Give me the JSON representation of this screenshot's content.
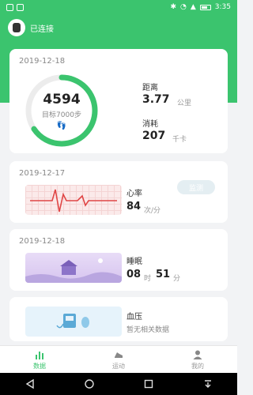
{
  "status": {
    "time": "3:35"
  },
  "device": {
    "connection_status": "已连接"
  },
  "steps_card": {
    "date": "2019-12-18",
    "steps": "4594",
    "target": "目标7000步",
    "progress": 0.656,
    "distance_label": "距离",
    "distance_value": "3.77",
    "distance_unit": "公里",
    "calorie_label": "消耗",
    "calorie_value": "207",
    "calorie_unit": "千卡"
  },
  "heart_card": {
    "date": "2019-12-17",
    "label": "心率",
    "value": "84",
    "unit": "次/分",
    "button": "监测"
  },
  "sleep_card": {
    "date": "2019-12-18",
    "label": "睡眠",
    "hours": "08",
    "hours_unit": "时",
    "minutes": "51",
    "minutes_unit": "分"
  },
  "bp_card": {
    "label": "血压",
    "empty": "暂无相关数据"
  },
  "tabs": [
    {
      "label": "数据",
      "icon": "bar-chart-icon",
      "active": true
    },
    {
      "label": "运动",
      "icon": "running-shoe-icon",
      "active": false
    },
    {
      "label": "我的",
      "icon": "person-icon",
      "active": false
    }
  ],
  "colors": {
    "accent": "#3bc46e",
    "heart": "#e04646"
  }
}
